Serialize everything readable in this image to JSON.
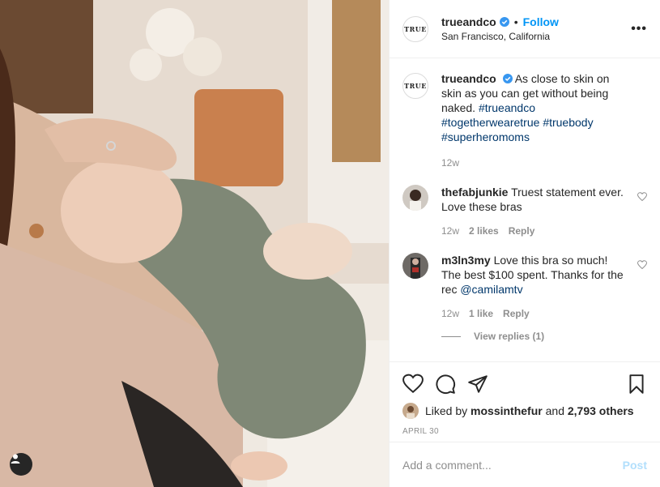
{
  "post": {
    "author": "trueandco",
    "author_avatar_text": "TRUE",
    "location": "San Francisco, California",
    "follow_label": "Follow",
    "separator": "•",
    "more_label": "•••",
    "caption": {
      "text": "As close to skin on skin as you can get without being naked.",
      "hashtags": [
        "#trueandco",
        "#togetherwearetrue",
        "#truebody",
        "#superheromoms"
      ],
      "time": "12w"
    },
    "comments": [
      {
        "user": "thefabjunkie",
        "text": "Truest statement ever. Love these bras",
        "time": "12w",
        "likes": "2 likes",
        "reply_label": "Reply"
      },
      {
        "user": "m3ln3my",
        "text": "Love this bra so much! The best $100 spent. Thanks for the rec",
        "mention": "@camilamtv",
        "time": "12w",
        "likes": "1 like",
        "reply_label": "Reply",
        "view_replies": "View replies (1)"
      }
    ],
    "liked_by_prefix": "Liked by",
    "liked_by_user": "mossinthefur",
    "liked_by_and": "and",
    "liked_by_others": "2,793 others",
    "date": "APRIL 30",
    "add_comment_placeholder": "Add a comment...",
    "post_label": "Post"
  },
  "icons": {
    "verified": "verified-badge-icon",
    "like": "heart-icon",
    "comment": "comment-icon",
    "share": "paper-plane-icon",
    "save": "bookmark-icon",
    "user_tags": "user-icon"
  },
  "colors": {
    "link_blue": "#0095f6",
    "hashtag": "#00376b",
    "muted": "#8e8e8e",
    "post_disabled": "#b2dffc"
  }
}
